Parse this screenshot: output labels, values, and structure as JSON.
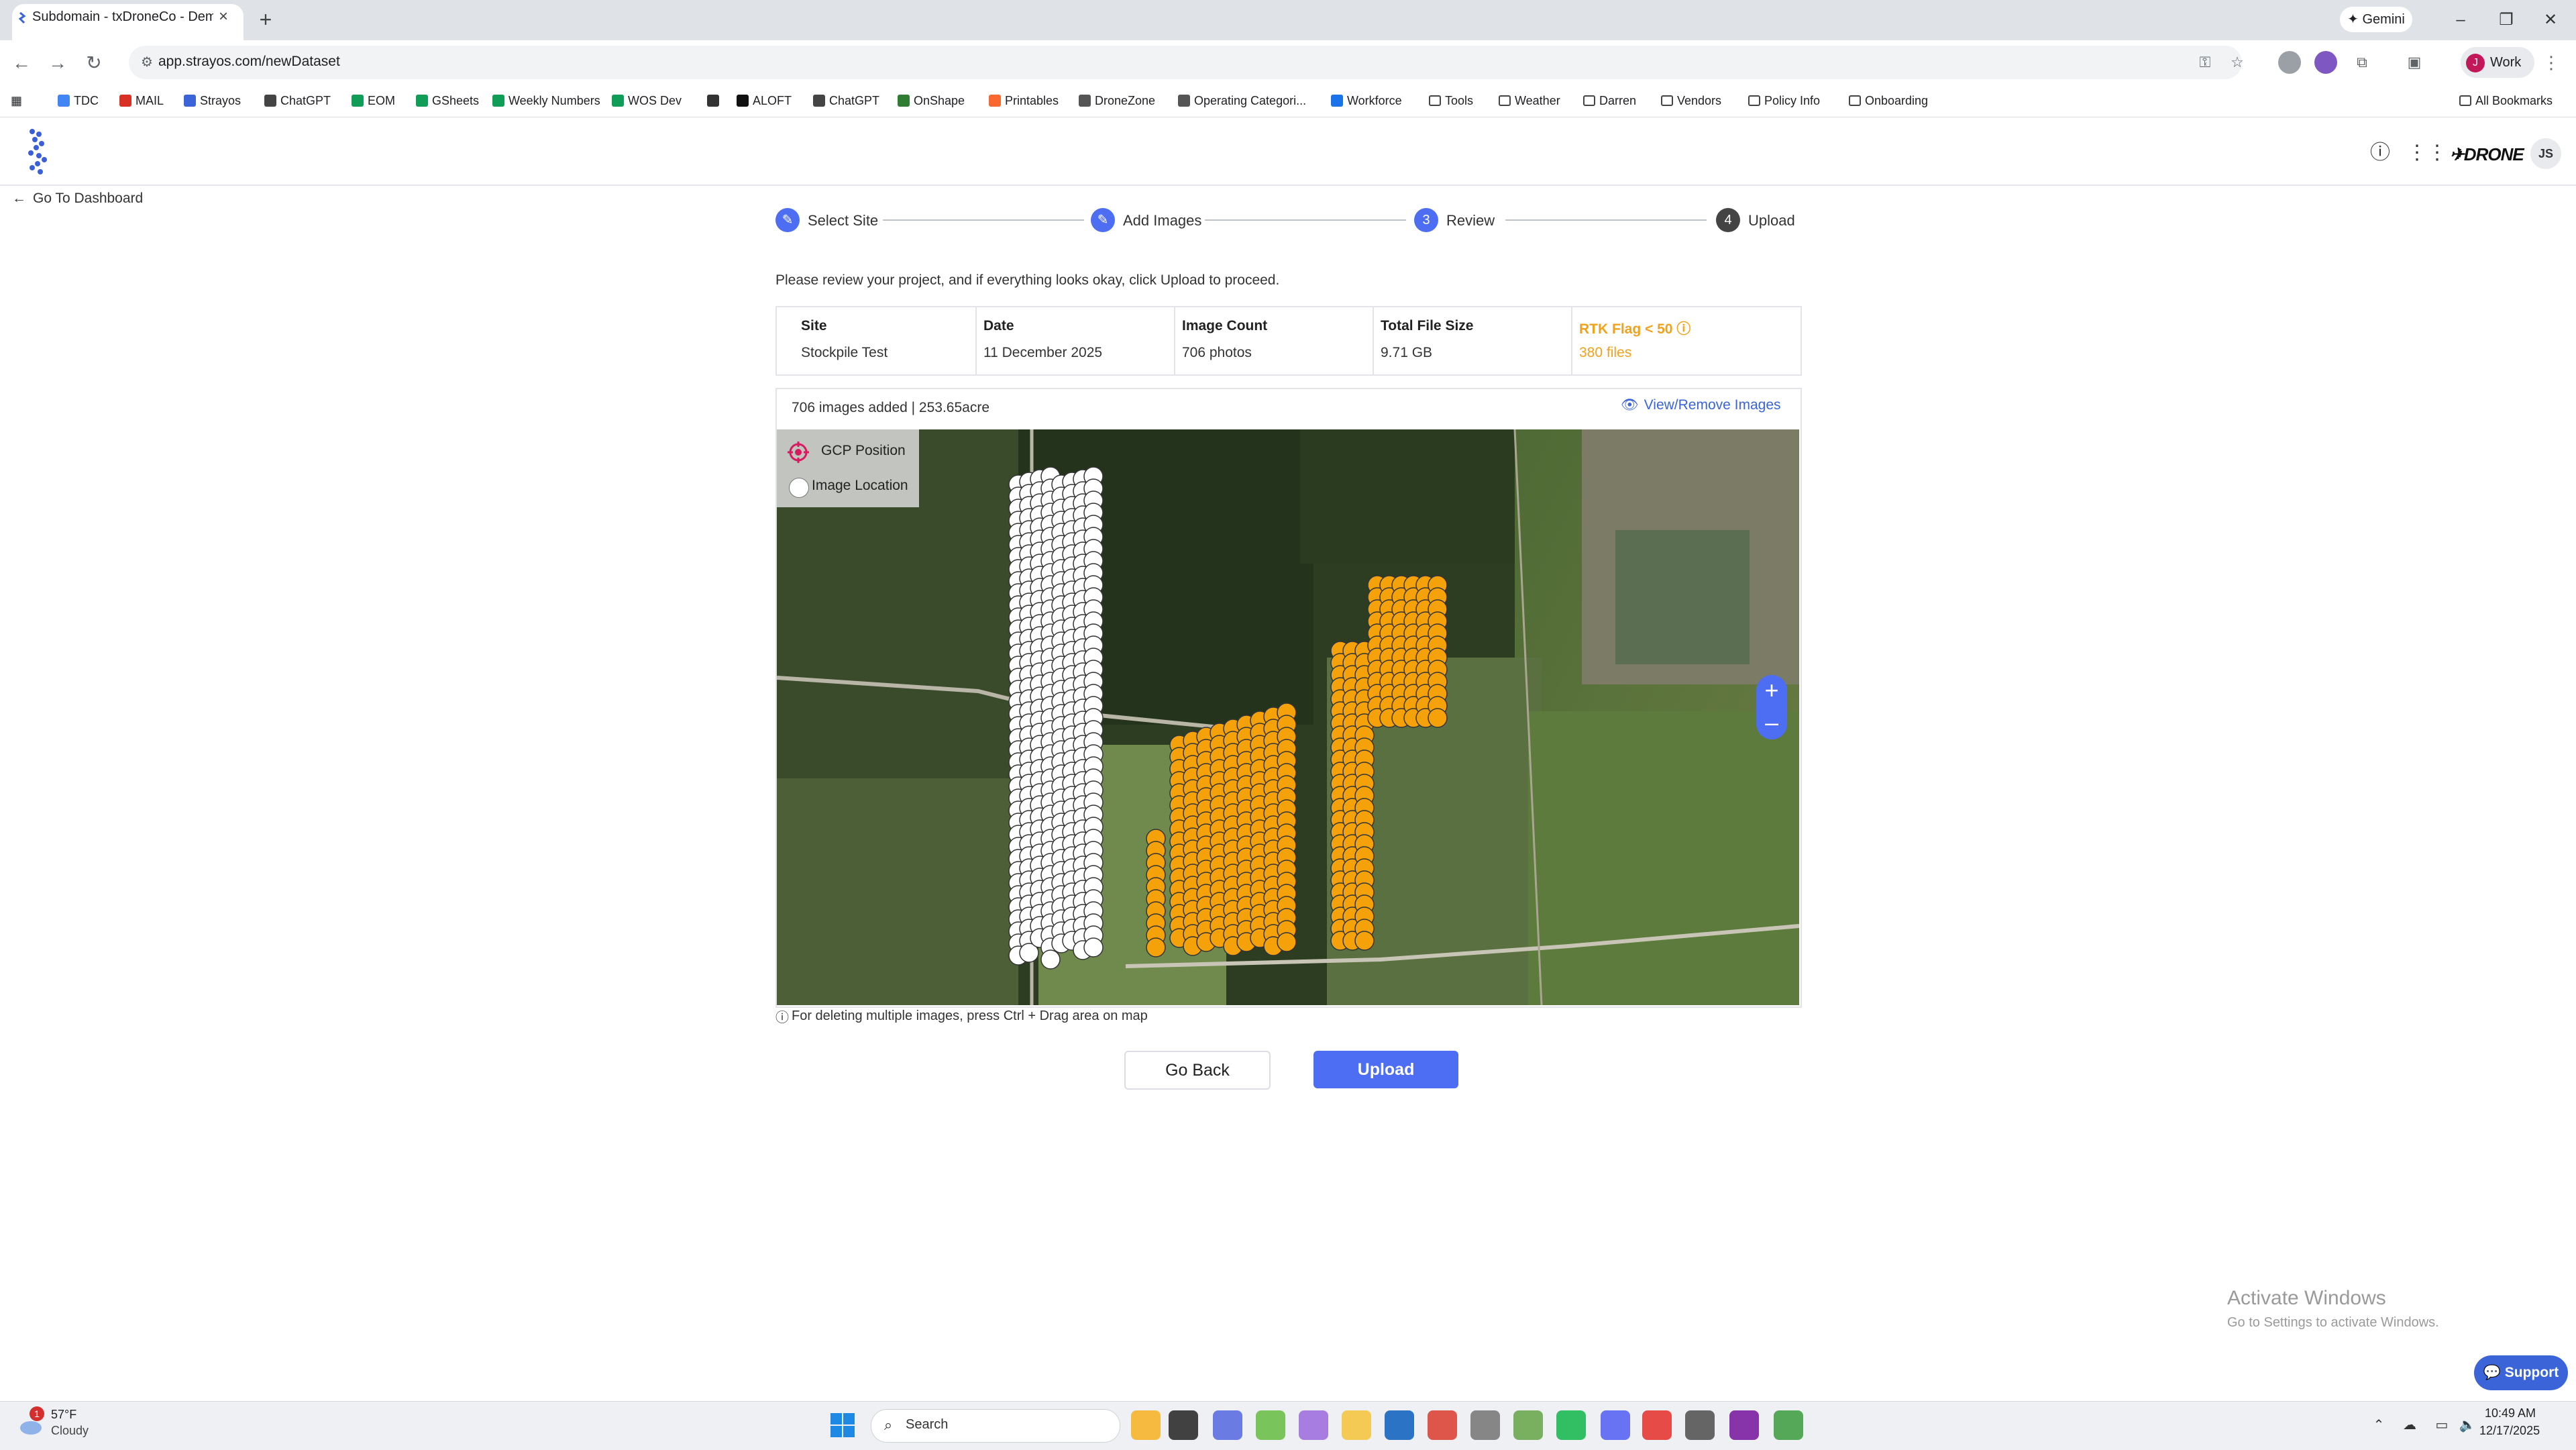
{
  "browser": {
    "tab_title": "Subdomain - txDroneCo - Dem",
    "url": "app.strayos.com/newDataset",
    "gemini_label": "Gemini",
    "profile_label": "Work",
    "profile_initial": "J"
  },
  "bookmarks": [
    {
      "label": "TDC",
      "icon": "tdc-icon",
      "color": "#4285f4"
    },
    {
      "label": "MAIL",
      "icon": "gmail-icon",
      "color": "#d93025"
    },
    {
      "label": "Strayos",
      "icon": "strayos-icon",
      "color": "#3a64d8"
    },
    {
      "label": "ChatGPT",
      "icon": "chatgpt-icon",
      "color": "#444444"
    },
    {
      "label": "EOM",
      "icon": "sheets-icon",
      "color": "#0f9d58"
    },
    {
      "label": "GSheets",
      "icon": "sheets-icon",
      "color": "#0f9d58"
    },
    {
      "label": "Weekly Numbers",
      "icon": "sheets-icon",
      "color": "#0f9d58"
    },
    {
      "label": "WOS Dev",
      "icon": "sheets-icon",
      "color": "#0f9d58"
    },
    {
      "label": "",
      "icon": "globe-icon",
      "color": "#333333"
    },
    {
      "label": "ALOFT",
      "icon": "aloft-icon",
      "color": "#111111"
    },
    {
      "label": "ChatGPT",
      "icon": "chatgpt-icon",
      "color": "#444444"
    },
    {
      "label": "OnShape",
      "icon": "onshape-icon",
      "color": "#2e7d32"
    },
    {
      "label": "Printables",
      "icon": "printables-icon",
      "color": "#fa6831"
    },
    {
      "label": "DroneZone",
      "icon": "dronezone-icon",
      "color": "#555555"
    },
    {
      "label": "Operating Categori...",
      "icon": "faa-icon",
      "color": "#555555"
    },
    {
      "label": "Workforce",
      "icon": "workforce-icon",
      "color": "#1a73e8"
    },
    {
      "label": "Tools",
      "icon": "folder-icon",
      "color": "#444444"
    },
    {
      "label": "Weather",
      "icon": "folder-icon",
      "color": "#444444"
    },
    {
      "label": "Darren",
      "icon": "folder-icon",
      "color": "#444444"
    },
    {
      "label": "Vendors",
      "icon": "folder-icon",
      "color": "#444444"
    },
    {
      "label": "Policy Info",
      "icon": "folder-icon",
      "color": "#444444"
    },
    {
      "label": "Onboarding",
      "icon": "folder-icon",
      "color": "#444444"
    }
  ],
  "all_bookmarks": "All Bookmarks",
  "app": {
    "back_label": "Go To Dashboard",
    "brand": "DRONE",
    "avatar_initials": "JS",
    "steps": [
      {
        "num": "✎",
        "label": "Select Site",
        "state": "done"
      },
      {
        "num": "✎",
        "label": "Add Images",
        "state": "done"
      },
      {
        "num": "3",
        "label": "Review",
        "state": "current"
      },
      {
        "num": "4",
        "label": "Upload",
        "state": "todo"
      }
    ],
    "instruction": "Please review your project, and if everything looks okay, click Upload to proceed.",
    "summary": {
      "site_h": "Site",
      "site_v": "Stockpile Test",
      "date_h": "Date",
      "date_v": "11 December 2025",
      "count_h": "Image Count",
      "count_v": "706 photos",
      "size_h": "Total File Size",
      "size_v": "9.71 GB",
      "rtk_h": "RTK Flag < 50",
      "rtk_v": "380 files"
    },
    "images_added": "706 images added | 253.65acre",
    "view_remove": "View/Remove Images",
    "legend_gcp": "GCP Position",
    "legend_img": "Image Location",
    "zoom_in": "+",
    "zoom_out": "–",
    "hint": "For deleting multiple images, press Ctrl + Drag area on map",
    "go_back": "Go Back",
    "upload": "Upload",
    "colors": {
      "accent": "#4d6ef2",
      "rtk": "#f0a21c",
      "marker_flagged": "#f5a20a",
      "marker_ok": "#ffffff"
    }
  },
  "windows": {
    "activate_title": "Activate Windows",
    "activate_sub": "Go to Settings to activate Windows.",
    "support": "Support"
  },
  "taskbar": {
    "weather_badge": "1",
    "temp": "57°F",
    "condition": "Cloudy",
    "search": "Search",
    "time": "10:49 AM",
    "date": "12/17/2025"
  }
}
